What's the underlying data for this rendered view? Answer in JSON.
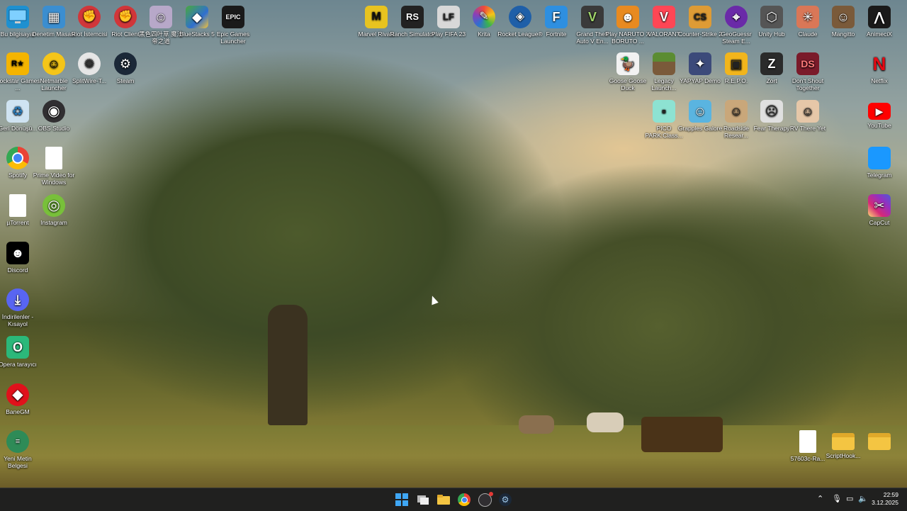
{
  "colors": {
    "taskbar_bg": "#20201f",
    "label_text": "#ffffff",
    "accent_blue": "#0078d4"
  },
  "desktop_icons": [
    {
      "id": "bu-bilgisayar",
      "label": "Bu bilgisayar",
      "icon": "monitor-icon",
      "color": "#1e90d0",
      "glyph": ""
    },
    {
      "id": "denetim-masasi",
      "label": "Denetim Masası",
      "icon": "control-panel-icon",
      "color": "#3b8ed0",
      "glyph": "▦"
    },
    {
      "id": "riot-istemcisi",
      "label": "Riot İstemcisi",
      "icon": "riot-fist-icon",
      "color": "#d13639",
      "glyph": "✊"
    },
    {
      "id": "riot-client",
      "label": "Riot Client",
      "icon": "riot-fist-icon",
      "color": "#d13639",
      "glyph": "✊"
    },
    {
      "id": "black-myth",
      "label": "黑色四叶草 魔法帝之道",
      "icon": "anime-character-icon",
      "color": "#b7a8c9",
      "glyph": "☺"
    },
    {
      "id": "bluestacks",
      "label": "BlueStacks 5",
      "icon": "bluestacks-icon",
      "color": "#4aa83e",
      "glyph": "◆"
    },
    {
      "id": "epic-games",
      "label": "Epic Games Launcher",
      "icon": "epic-games-icon",
      "color": "#1a1a1a",
      "glyph": "EPIC"
    },
    {
      "id": "marvel-rivals",
      "label": "Marvel Rivals",
      "icon": "marvel-rivals-icon",
      "color": "#e8c320",
      "glyph": "M"
    },
    {
      "id": "ranch-simulator",
      "label": "Ranch Simulator",
      "icon": "ranch-simulator-icon",
      "color": "#222222",
      "glyph": "RS"
    },
    {
      "id": "play-fifa",
      "label": "Play FIFA 23",
      "icon": "fifa-icon",
      "color": "#d8d8d8",
      "glyph": "LF"
    },
    {
      "id": "krita",
      "label": "Krita",
      "icon": "krita-icon",
      "color": "#8a3fb8",
      "glyph": "✎"
    },
    {
      "id": "rocket-league",
      "label": "Rocket League®",
      "icon": "rocket-league-icon",
      "color": "#1f5fa8",
      "glyph": "◈"
    },
    {
      "id": "fortnite",
      "label": "Fortnite",
      "icon": "fortnite-icon",
      "color": "#2e8fe0",
      "glyph": "F"
    },
    {
      "id": "gta5",
      "label": "Grand Theft Auto V En...",
      "icon": "gta-icon",
      "color": "#3a3a3a",
      "glyph": "V"
    },
    {
      "id": "naruto",
      "label": "Play NARUTO X BORUTO ...",
      "icon": "naruto-icon",
      "color": "#e88a20",
      "glyph": "☻"
    },
    {
      "id": "valorant",
      "label": "VALORANT",
      "icon": "valorant-icon",
      "color": "#ff4655",
      "glyph": "V"
    },
    {
      "id": "counter-strike",
      "label": "Counter-Strike 2",
      "icon": "counter-strike-icon",
      "color": "#de9b35",
      "glyph": "CS"
    },
    {
      "id": "geoguessr",
      "label": "GeoGuessr Steam E...",
      "icon": "geoguessr-icon",
      "color": "#6a2aa8",
      "glyph": "⌖"
    },
    {
      "id": "unity-hub",
      "label": "Unity Hub",
      "icon": "unity-icon",
      "color": "#555555",
      "glyph": "⬡"
    },
    {
      "id": "claude",
      "label": "Claude",
      "icon": "claude-icon",
      "color": "#d97757",
      "glyph": "✳"
    },
    {
      "id": "mangitto",
      "label": "Mangitto",
      "icon": "mangitto-icon",
      "color": "#7a5a3a",
      "glyph": "☺"
    },
    {
      "id": "animecix",
      "label": "AnimeciX",
      "icon": "animecix-icon",
      "color": "#1a1a1a",
      "glyph": "⋀"
    },
    {
      "id": "rockstar",
      "label": "Rockstar Games ...",
      "icon": "rockstar-icon",
      "color": "#f4b400",
      "glyph": "R★"
    },
    {
      "id": "netmarble",
      "label": "Netmarble Launcher",
      "icon": "netmarble-icon",
      "color": "#f5c518",
      "glyph": "☺"
    },
    {
      "id": "splitwire",
      "label": "SplitWire-T...",
      "icon": "splitwire-icon",
      "color": "#e6e6e6",
      "glyph": "✺"
    },
    {
      "id": "steam",
      "label": "Steam",
      "icon": "steam-icon",
      "color": "#1b2838",
      "glyph": "⚙"
    },
    {
      "id": "goose",
      "label": "Goose Goose Duck",
      "icon": "goose-icon",
      "color": "#f2f2f2",
      "glyph": "🦆"
    },
    {
      "id": "legacy-launcher",
      "label": "Legacy Launch...",
      "icon": "minecraft-block-icon",
      "color": "#5b8c32",
      "glyph": "■"
    },
    {
      "id": "yapyap",
      "label": "YAPYAP Demo",
      "icon": "yapyap-icon",
      "color": "#3c4a7a",
      "glyph": "✦"
    },
    {
      "id": "repo",
      "label": "R.E.P.O.",
      "icon": "repo-icon",
      "color": "#f2b51c",
      "glyph": "▣"
    },
    {
      "id": "zort",
      "label": "Zort",
      "icon": "zort-icon",
      "color": "#2b2b2b",
      "glyph": "Z"
    },
    {
      "id": "dont-shout",
      "label": "Don't Shout Together",
      "icon": "dont-shout-icon",
      "color": "#7a1a2a",
      "glyph": "DS"
    },
    {
      "id": "netflix",
      "label": "Netflix",
      "icon": "netflix-icon",
      "color": "#000000",
      "glyph": "N"
    },
    {
      "id": "geri-donusum",
      "label": "Geri Dönüşü...",
      "icon": "recycle-bin-icon",
      "color": "#cfe3f2",
      "glyph": "♻"
    },
    {
      "id": "obs",
      "label": "OBS Studio",
      "icon": "obs-icon",
      "color": "#302e31",
      "glyph": "◉"
    },
    {
      "id": "pico-park",
      "label": "PICO PARK:Class...",
      "icon": "pico-park-icon",
      "color": "#8de2d2",
      "glyph": "▪"
    },
    {
      "id": "grapples",
      "label": "Grapples Galore",
      "icon": "grapples-icon",
      "color": "#5ab4e0",
      "glyph": "☺"
    },
    {
      "id": "roadside",
      "label": "Roadside Resear...",
      "icon": "roadside-icon",
      "color": "#c9a77a",
      "glyph": "☺"
    },
    {
      "id": "fear-therapy",
      "label": "Fear Therapy",
      "icon": "fear-therapy-icon",
      "color": "#e0e0e0",
      "glyph": "☹"
    },
    {
      "id": "rv-there-yet",
      "label": "RV There Yet",
      "icon": "rv-there-yet-icon",
      "color": "#e6c7a8",
      "glyph": "☺"
    },
    {
      "id": "youtube",
      "label": "YouTube",
      "icon": "youtube-icon",
      "color": "#ff0000",
      "glyph": "▶"
    },
    {
      "id": "google-chrome",
      "label": "Google Chrome",
      "icon": "chrome-icon",
      "color": "#ffffff",
      "glyph": "◎"
    },
    {
      "id": "spotify",
      "label": "Spotify",
      "icon": "file-icon",
      "color": "#ffffff",
      "glyph": ""
    },
    {
      "id": "prime-video",
      "label": "Prime Video for Windows",
      "icon": "prime-video-icon",
      "color": "#1a98ff",
      "glyph": "prime"
    },
    {
      "id": "telegram",
      "label": "Telegram",
      "icon": "file-icon",
      "color": "#ffffff",
      "glyph": ""
    },
    {
      "id": "utorrent",
      "label": "µTorrent",
      "icon": "utorrent-icon",
      "color": "#78c03a",
      "glyph": "µ"
    },
    {
      "id": "instagram",
      "label": "Instagram",
      "icon": "instagram-icon",
      "color": "#d6249f",
      "glyph": "◎"
    },
    {
      "id": "capcut",
      "label": "CapCut",
      "icon": "capcut-icon",
      "color": "#000000",
      "glyph": "✂"
    },
    {
      "id": "discord",
      "label": "Discord",
      "icon": "discord-icon",
      "color": "#5865f2",
      "glyph": "☻"
    },
    {
      "id": "indirilenler",
      "label": "İndirilenler - Kısayol",
      "icon": "downloads-icon",
      "color": "#2bb87a",
      "glyph": "⤓"
    },
    {
      "id": "opera",
      "label": "Opera tarayıcı",
      "icon": "opera-icon",
      "color": "#e0111b",
      "glyph": "O"
    },
    {
      "id": "banegm",
      "label": "BaneGM",
      "icon": "banegm-icon",
      "color": "#2e8b57",
      "glyph": "◆"
    },
    {
      "id": "yeni-metin",
      "label": "Yeni Metin Belgesi",
      "icon": "text-file-icon",
      "color": "#ffffff",
      "glyph": "≡"
    },
    {
      "id": "folder-57603c",
      "label": "57603c-Ra...",
      "icon": "folder-icon",
      "color": "#f4c542",
      "glyph": ""
    },
    {
      "id": "scripthook",
      "label": "ScriptHook...",
      "icon": "folder-icon",
      "color": "#f4c542",
      "glyph": ""
    }
  ],
  "taskbar": {
    "apps": [
      {
        "id": "start",
        "icon": "windows-start-icon"
      },
      {
        "id": "task-view",
        "icon": "task-view-icon"
      },
      {
        "id": "file-explorer",
        "icon": "file-explorer-icon"
      },
      {
        "id": "chrome",
        "icon": "chrome-icon"
      },
      {
        "id": "obs",
        "icon": "obs-icon"
      },
      {
        "id": "steam",
        "icon": "steam-icon"
      }
    ],
    "tray_icons": [
      "chevron-up-icon",
      "microphone-icon",
      "display-icon",
      "speaker-icon"
    ],
    "time": "22:59",
    "date": "3.12.2025"
  }
}
